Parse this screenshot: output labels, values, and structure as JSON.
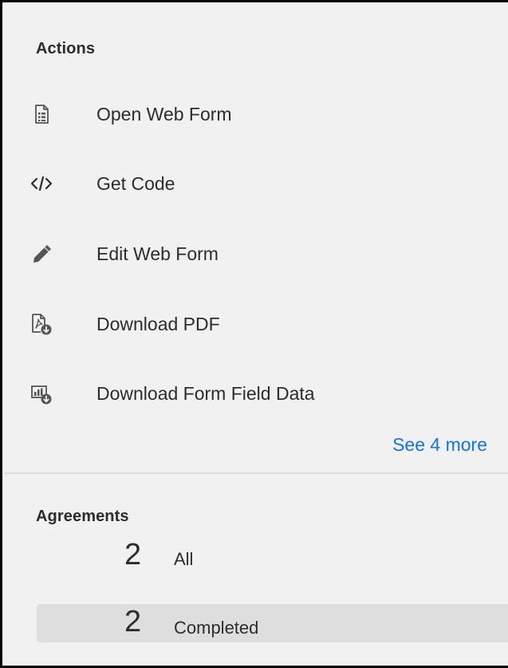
{
  "actions": {
    "title": "Actions",
    "items": [
      {
        "label": "Open Web Form",
        "icon": "web-form-document-icon"
      },
      {
        "label": "Get Code",
        "icon": "code-icon"
      },
      {
        "label": "Edit Web Form",
        "icon": "pencil-icon"
      },
      {
        "label": "Download PDF",
        "icon": "pdf-download-icon"
      },
      {
        "label": "Download Form Field Data",
        "icon": "chart-download-icon"
      }
    ],
    "see_more": "See 4 more"
  },
  "agreements": {
    "title": "Agreements",
    "rows": [
      {
        "count": "2",
        "label": "All",
        "selected": false
      },
      {
        "count": "2",
        "label": "Completed",
        "selected": true
      }
    ]
  },
  "colors": {
    "link": "#1473e6",
    "panel_bg": "#f1f1f1",
    "selected_bg": "#dedede",
    "text": "#2c2c2c"
  }
}
